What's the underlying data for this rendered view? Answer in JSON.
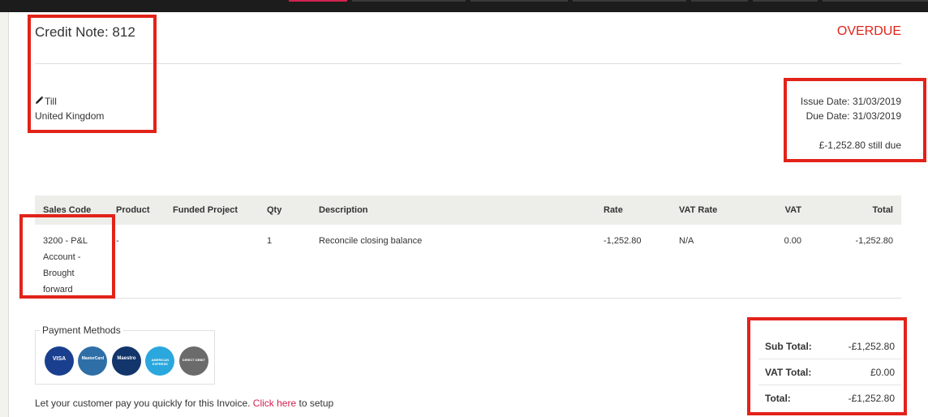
{
  "header": {
    "title": "Credit Note: 812",
    "status": "OVERDUE",
    "status_color": "#e2231a"
  },
  "customer": {
    "edit_icon": "pencil-icon",
    "name": "Till",
    "country": "United Kingdom"
  },
  "dates": {
    "issue": "Issue Date: 31/03/2019",
    "due": "Due Date: 31/03/2019",
    "still_due": "£-1,252.80 still due"
  },
  "table": {
    "columns": [
      "Sales Code",
      "Product",
      "Funded Project",
      "Qty",
      "Description",
      "Rate",
      "VAT Rate",
      "VAT",
      "Total"
    ],
    "rows": [
      {
        "sales_code": "3200 - P&L Account - Brought forward",
        "product": "-",
        "funded_project": "",
        "qty": "1",
        "description": "Reconcile closing balance",
        "rate": "-1,252.80",
        "vat_rate": "N/A",
        "vat": "0.00",
        "total": "-1,252.80"
      }
    ]
  },
  "payment": {
    "legend": "Payment Methods",
    "cards": [
      {
        "icon": "visa-icon",
        "label": "VISA",
        "color": "#1a3f8f"
      },
      {
        "icon": "mastercard-icon",
        "label": "MasterCard",
        "color": "#2f6fa7"
      },
      {
        "icon": "maestro-icon",
        "label": "Maestro",
        "color": "#12356b"
      },
      {
        "icon": "amex-icon",
        "label": "AMERICAN EXPRESS",
        "color": "#2aa7dd"
      },
      {
        "icon": "direct-debit-icon",
        "label": "DIRECT DEBIT",
        "color": "#6b6b6b"
      }
    ],
    "setup_prefix": "Let your customer pay you quickly for this Invoice.",
    "setup_link": "Click here",
    "setup_suffix": "to setup",
    "link_color": "#d2234f"
  },
  "totals": {
    "sub_total_label": "Sub Total:",
    "sub_total": "-£1,252.80",
    "vat_total_label": "VAT Total:",
    "vat_total": "£0.00",
    "total_label": "Total:",
    "total": "-£1,252.80"
  },
  "highlight_color": "#e2231a"
}
